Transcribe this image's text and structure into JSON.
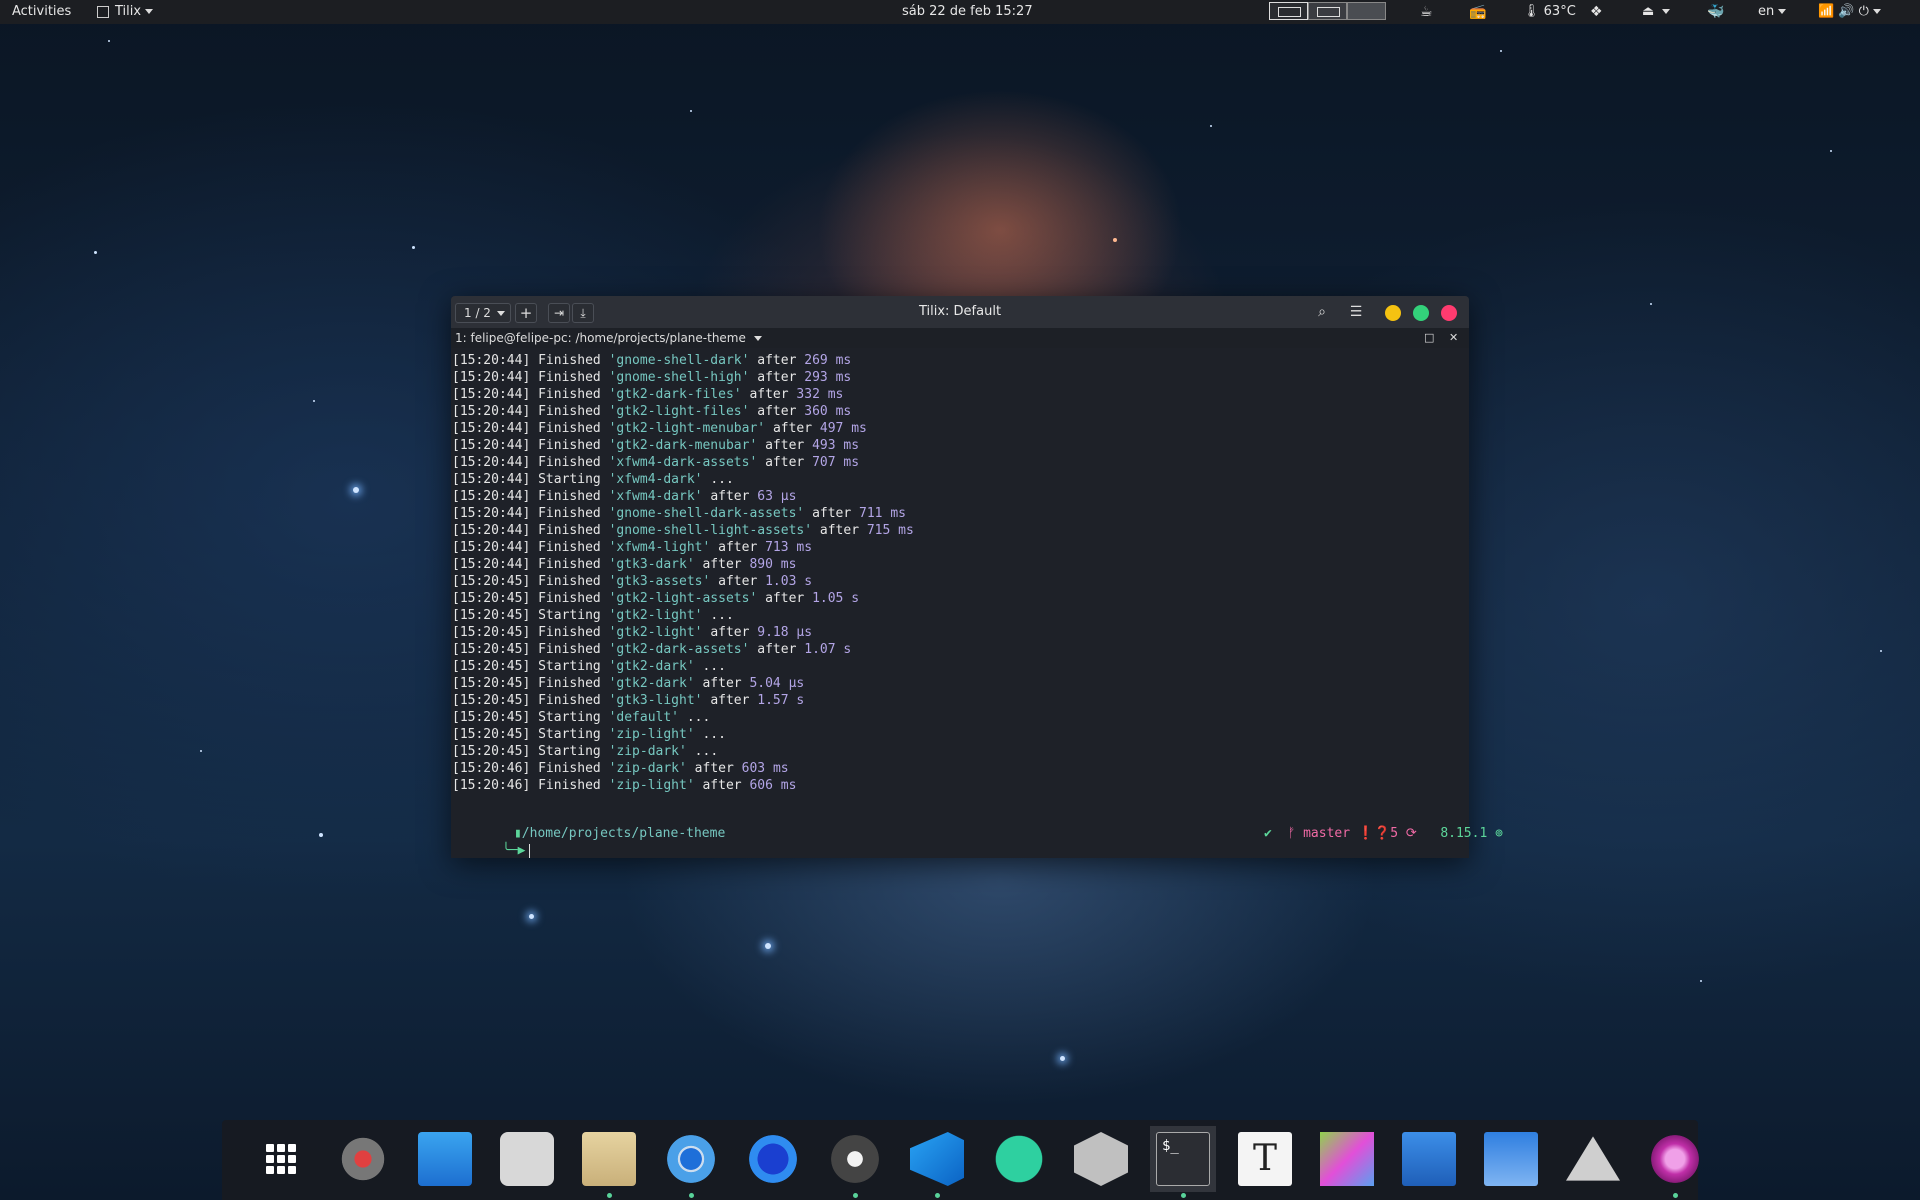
{
  "topbar": {
    "activities": "Activities",
    "app_menu": "Tilix",
    "clock": "sáb 22 de feb  15:27",
    "temperature": "63°C",
    "language": "en"
  },
  "window": {
    "title": "Tilix: Default",
    "session_counter": "1 / 2",
    "terminal_title": "1: felipe@felipe-pc: /home/projects/plane-theme",
    "close_glyph": "✕",
    "maximize_glyph": "□",
    "controls": {
      "minimize_color": "#f5c211",
      "maximize_color": "#33d17a",
      "close_color": "#ff3b6f"
    }
  },
  "terminal": {
    "lines": [
      {
        "ts": "[15:20:44]",
        "verb": "Finished",
        "task": "'gnome-shell-dark'",
        "after": "after",
        "num": "269",
        "unit": "ms"
      },
      {
        "ts": "[15:20:44]",
        "verb": "Finished",
        "task": "'gnome-shell-high'",
        "after": "after",
        "num": "293",
        "unit": "ms"
      },
      {
        "ts": "[15:20:44]",
        "verb": "Finished",
        "task": "'gtk2-dark-files'",
        "after": "after",
        "num": "332",
        "unit": "ms"
      },
      {
        "ts": "[15:20:44]",
        "verb": "Finished",
        "task": "'gtk2-light-files'",
        "after": "after",
        "num": "360",
        "unit": "ms"
      },
      {
        "ts": "[15:20:44]",
        "verb": "Finished",
        "task": "'gtk2-light-menubar'",
        "after": "after",
        "num": "497",
        "unit": "ms"
      },
      {
        "ts": "[15:20:44]",
        "verb": "Finished",
        "task": "'gtk2-dark-menubar'",
        "after": "after",
        "num": "493",
        "unit": "ms"
      },
      {
        "ts": "[15:20:44]",
        "verb": "Finished",
        "task": "'xfwm4-dark-assets'",
        "after": "after",
        "num": "707",
        "unit": "ms"
      },
      {
        "ts": "[15:20:44]",
        "verb": "Starting",
        "task": "'xfwm4-dark'",
        "after": "...",
        "num": "",
        "unit": ""
      },
      {
        "ts": "[15:20:44]",
        "verb": "Finished",
        "task": "'xfwm4-dark'",
        "after": "after",
        "num": "63",
        "unit": "μs"
      },
      {
        "ts": "[15:20:44]",
        "verb": "Finished",
        "task": "'gnome-shell-dark-assets'",
        "after": "after",
        "num": "711",
        "unit": "ms"
      },
      {
        "ts": "[15:20:44]",
        "verb": "Finished",
        "task": "'gnome-shell-light-assets'",
        "after": "after",
        "num": "715",
        "unit": "ms"
      },
      {
        "ts": "[15:20:44]",
        "verb": "Finished",
        "task": "'xfwm4-light'",
        "after": "after",
        "num": "713",
        "unit": "ms"
      },
      {
        "ts": "[15:20:44]",
        "verb": "Finished",
        "task": "'gtk3-dark'",
        "after": "after",
        "num": "890",
        "unit": "ms"
      },
      {
        "ts": "[15:20:45]",
        "verb": "Finished",
        "task": "'gtk3-assets'",
        "after": "after",
        "num": "1.03",
        "unit": "s"
      },
      {
        "ts": "[15:20:45]",
        "verb": "Finished",
        "task": "'gtk2-light-assets'",
        "after": "after",
        "num": "1.05",
        "unit": "s"
      },
      {
        "ts": "[15:20:45]",
        "verb": "Starting",
        "task": "'gtk2-light'",
        "after": "...",
        "num": "",
        "unit": ""
      },
      {
        "ts": "[15:20:45]",
        "verb": "Finished",
        "task": "'gtk2-light'",
        "after": "after",
        "num": "9.18",
        "unit": "μs"
      },
      {
        "ts": "[15:20:45]",
        "verb": "Finished",
        "task": "'gtk2-dark-assets'",
        "after": "after",
        "num": "1.07",
        "unit": "s"
      },
      {
        "ts": "[15:20:45]",
        "verb": "Starting",
        "task": "'gtk2-dark'",
        "after": "...",
        "num": "",
        "unit": ""
      },
      {
        "ts": "[15:20:45]",
        "verb": "Finished",
        "task": "'gtk2-dark'",
        "after": "after",
        "num": "5.04",
        "unit": "μs"
      },
      {
        "ts": "[15:20:45]",
        "verb": "Finished",
        "task": "'gtk3-light'",
        "after": "after",
        "num": "1.57",
        "unit": "s"
      },
      {
        "ts": "[15:20:45]",
        "verb": "Starting",
        "task": "'default'",
        "after": "...",
        "num": "",
        "unit": ""
      },
      {
        "ts": "[15:20:45]",
        "verb": "Starting",
        "task": "'zip-light'",
        "after": "...",
        "num": "",
        "unit": ""
      },
      {
        "ts": "[15:20:45]",
        "verb": "Starting",
        "task": "'zip-dark'",
        "after": "...",
        "num": "",
        "unit": ""
      },
      {
        "ts": "[15:20:46]",
        "verb": "Finished",
        "task": "'zip-dark'",
        "after": "after",
        "num": "603",
        "unit": "ms"
      },
      {
        "ts": "[15:20:46]",
        "verb": "Finished",
        "task": "'zip-light'",
        "after": "after",
        "num": "606",
        "unit": "ms"
      }
    ],
    "prompt": {
      "path": "/home/projects/plane-theme",
      "check": "✔",
      "branch_glyph": "ᚠ",
      "branch": "master",
      "status_glyphs": "❗❓",
      "status_count": "5",
      "version": "8.15.1",
      "end_glyph": "⊚",
      "arrow": "╰─▶"
    }
  },
  "dock": {
    "items": [
      {
        "name": "show-applications-icon",
        "running": false
      },
      {
        "name": "settings-icon",
        "running": false
      },
      {
        "name": "downloader-icon",
        "running": false
      },
      {
        "name": "tweaks-icon",
        "running": false
      },
      {
        "name": "files-icon",
        "running": true
      },
      {
        "name": "chromium-icon",
        "running": true
      },
      {
        "name": "firefox-icon",
        "running": false
      },
      {
        "name": "skype-icon",
        "running": true
      },
      {
        "name": "vscode-icon",
        "running": true
      },
      {
        "name": "atom-icon",
        "running": false
      },
      {
        "name": "hex-editor-icon",
        "running": false
      },
      {
        "name": "tilix-icon",
        "running": true
      },
      {
        "name": "typora-icon",
        "running": false
      },
      {
        "name": "gtk-inspector-icon",
        "running": false
      },
      {
        "name": "glade-icon",
        "running": false
      },
      {
        "name": "disk-usage-icon",
        "running": false
      },
      {
        "name": "inkscape-icon",
        "running": false
      },
      {
        "name": "pinta-icon",
        "running": true
      }
    ]
  }
}
